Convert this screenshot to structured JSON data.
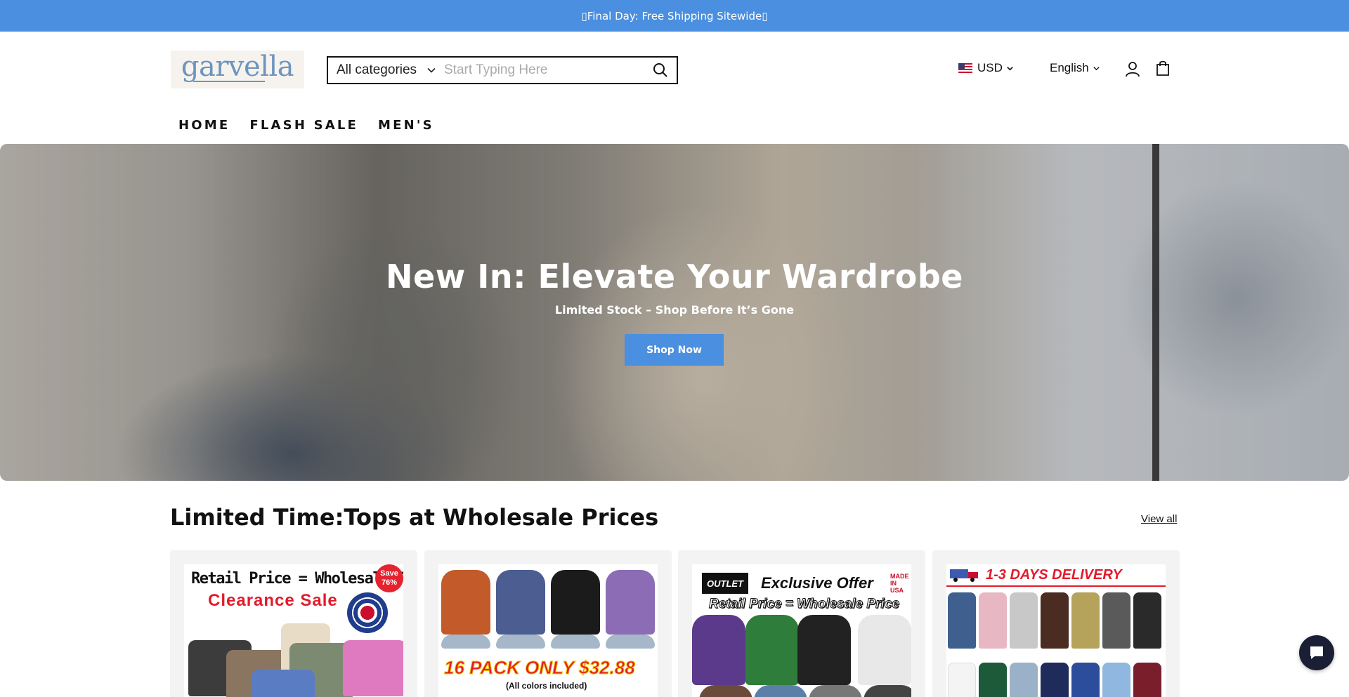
{
  "announcement": {
    "text": "▯Final Day: Free Shipping Sitewide▯"
  },
  "header": {
    "logo_text": "garvella",
    "search": {
      "category_label": "All categories",
      "placeholder": "Start Typing Here",
      "value": ""
    },
    "currency": "USD",
    "language": "English",
    "icons": [
      "chevron-down-icon",
      "search-icon",
      "us-flag-icon",
      "account-icon",
      "cart-icon"
    ]
  },
  "nav": {
    "items": [
      {
        "label": "HOME"
      },
      {
        "label": "FLASH SALE"
      },
      {
        "label": "MEN'S"
      }
    ]
  },
  "hero": {
    "title": "New In: Elevate Your Wardrobe",
    "subtitle": "Limited Stock – Shop Before It’s Gone",
    "button_label": "Shop Now"
  },
  "collection": {
    "title": "Limited Time:Tops at Wholesale Prices",
    "view_all": "View all",
    "cards": [
      {
        "headline": "Retail Price = Wholesale Pr",
        "sale_text": "Clearance Sale",
        "badge_line1": "Save",
        "badge_line2": "76%"
      },
      {
        "pack_text": "16 PACK ONLY $32.88",
        "note": "(All colors included)"
      },
      {
        "outlet": "OUTLET",
        "offer": "Exclusive Offer",
        "made_in": "MADE IN USA",
        "price_line": "Retail  Price = Wholesale  Price"
      },
      {
        "delivery": "1-3 DAYS DELIVERY"
      }
    ]
  },
  "colors": {
    "accent_blue": "#4a8fe0",
    "text_dark": "#121212",
    "sale_red": "#e21b2b",
    "chat_bg": "#1a1f36"
  }
}
